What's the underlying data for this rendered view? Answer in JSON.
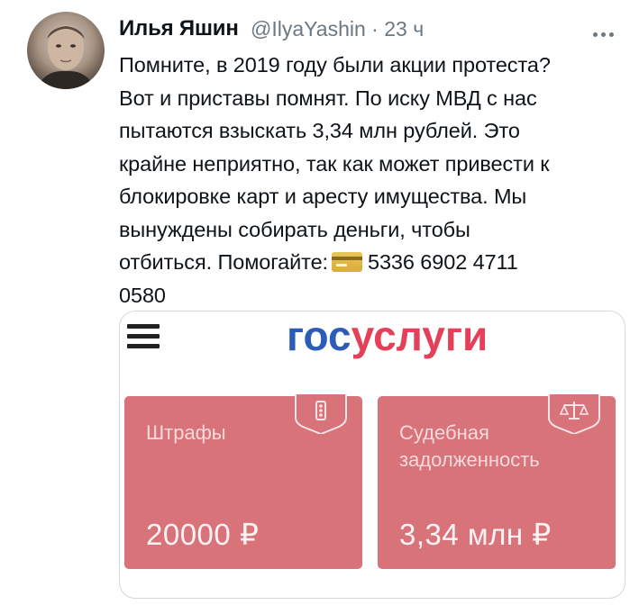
{
  "tweet": {
    "author_name": "Илья Яшин",
    "handle": "@IlyaYashin",
    "separator": "·",
    "time_ago": "23 ч",
    "text_lines": [
      "Помните, в 2019 году были акции протеста?",
      "Вот и приставы помнят. По иску МВД с нас",
      "пытаются взыскать 3,34 млн рублей. Это",
      "крайне неприятно, так как может привести к",
      "блокировке карт и аресту имущества. Мы",
      "вынуждены собирать деньги, чтобы"
    ],
    "text_help_prefix": "отбиться. Помогайте:",
    "text_card_number_part1": "5336 6902 4711",
    "text_card_number_part2": "0580",
    "more_icon": "three-dots-icon",
    "card_emoji_icon": "credit-card-emoji-icon"
  },
  "media": {
    "logo_part1": "гос",
    "logo_part2": "услуги",
    "menu_icon": "hamburger-menu-icon",
    "tiles": [
      {
        "label": "Штрафы",
        "amount": "20000 ₽",
        "icon": "traffic-light-icon"
      },
      {
        "label_line1": "Судебная",
        "label_line2": "задолженность",
        "amount": "3,34 млн ₽",
        "icon": "scales-icon"
      }
    ]
  },
  "colors": {
    "logo_blue": "#2d5cb8",
    "logo_red": "#e4405a",
    "tile_pink": "#d9737a",
    "meta_gray": "#6d7780"
  }
}
